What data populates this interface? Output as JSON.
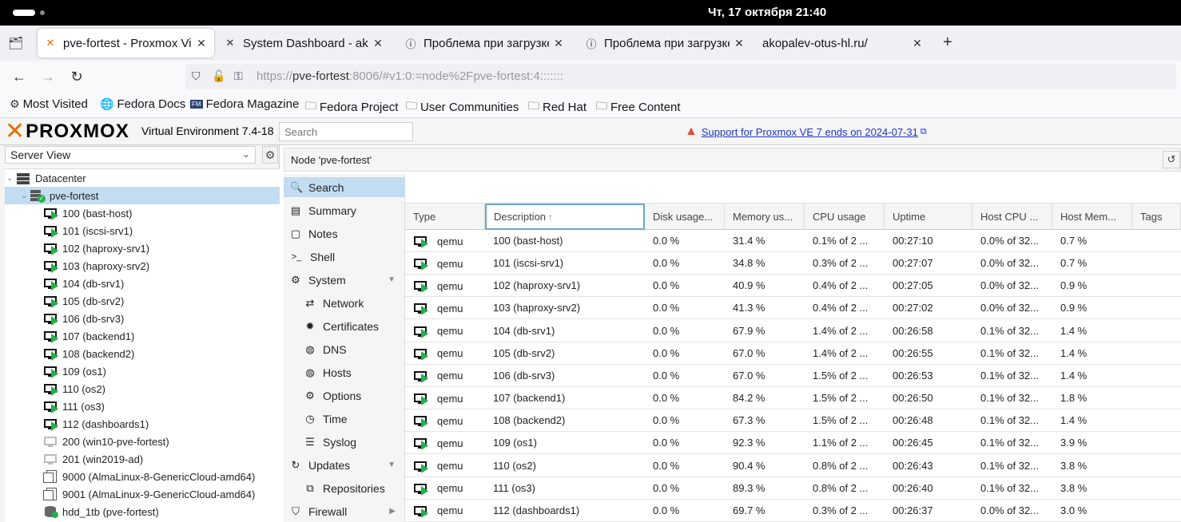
{
  "system": {
    "clock": "Чт, 17 октября  21:40"
  },
  "browser": {
    "tabs": [
      {
        "title": "pve-fortest - Proxmox Virtual Environment",
        "active": true,
        "icon": "proxmox-x-icon"
      },
      {
        "title": "System Dashboard - akopalev",
        "active": false,
        "icon": "jira-icon"
      },
      {
        "title": "Проблема при загрузке страницы",
        "active": false,
        "icon": "info-icon"
      },
      {
        "title": "Проблема при загрузке страницы",
        "active": false,
        "icon": "info-icon"
      },
      {
        "title": "akopalev-otus-hl.ru/",
        "active": false,
        "icon": ""
      }
    ],
    "url_prefix": "https://",
    "url_host": "pve-fortest",
    "url_rest": ":8006/#v1:0:=node%2Fpve-fortest:4:::::::",
    "bookmarks": [
      "Most Visited",
      "Fedora Docs",
      "Fedora Magazine",
      "Fedora Project",
      "User Communities",
      "Red Hat",
      "Free Content"
    ]
  },
  "pve": {
    "logo_text": "PROXMOX",
    "title": "Virtual Environment 7.4-18",
    "search_placeholder": "Search",
    "warning": "Support for Proxmox VE 7 ends on 2024-07-31",
    "view": "Server View",
    "tree": [
      {
        "label": "Datacenter",
        "kind": "datacenter"
      },
      {
        "label": "pve-fortest",
        "kind": "node",
        "selected": true
      },
      {
        "label": "100 (bast-host)",
        "kind": "vm-running"
      },
      {
        "label": "101 (iscsi-srv1)",
        "kind": "vm-running"
      },
      {
        "label": "102 (haproxy-srv1)",
        "kind": "vm-running"
      },
      {
        "label": "103 (haproxy-srv2)",
        "kind": "vm-running"
      },
      {
        "label": "104 (db-srv1)",
        "kind": "vm-running"
      },
      {
        "label": "105 (db-srv2)",
        "kind": "vm-running"
      },
      {
        "label": "106 (db-srv3)",
        "kind": "vm-running"
      },
      {
        "label": "107 (backend1)",
        "kind": "vm-running"
      },
      {
        "label": "108 (backend2)",
        "kind": "vm-running"
      },
      {
        "label": "109 (os1)",
        "kind": "vm-running"
      },
      {
        "label": "110 (os2)",
        "kind": "vm-running"
      },
      {
        "label": "111 (os3)",
        "kind": "vm-running"
      },
      {
        "label": "112 (dashboards1)",
        "kind": "vm-running"
      },
      {
        "label": "200 (win10-pve-fortest)",
        "kind": "vm-stopped"
      },
      {
        "label": "201 (win2019-ad)",
        "kind": "vm-stopped"
      },
      {
        "label": "9000 (AlmaLinux-8-GenericCloud-amd64)",
        "kind": "template"
      },
      {
        "label": "9001 (AlmaLinux-9-GenericCloud-amd64)",
        "kind": "template"
      },
      {
        "label": "hdd_1tb (pve-fortest)",
        "kind": "storage"
      }
    ],
    "node_header": "Node 'pve-fortest'",
    "menu": [
      {
        "label": "Search",
        "icon": "search-icon",
        "glyph": "🔍",
        "selected": true
      },
      {
        "label": "Summary",
        "icon": "book-icon",
        "glyph": "▤"
      },
      {
        "label": "Notes",
        "icon": "notes-icon",
        "glyph": "▢"
      },
      {
        "label": "Shell",
        "icon": "terminal-icon",
        "glyph": ">_"
      },
      {
        "label": "System",
        "icon": "cogs-icon",
        "glyph": "⚙",
        "expandable": true
      },
      {
        "label": "Network",
        "icon": "exchange-icon",
        "glyph": "⇄",
        "sub": true
      },
      {
        "label": "Certificates",
        "icon": "certificate-icon",
        "glyph": "✹",
        "sub": true
      },
      {
        "label": "DNS",
        "icon": "globe-icon",
        "glyph": "◍",
        "sub": true
      },
      {
        "label": "Hosts",
        "icon": "globe-icon",
        "glyph": "◍",
        "sub": true
      },
      {
        "label": "Options",
        "icon": "gear-icon",
        "glyph": "⚙",
        "sub": true
      },
      {
        "label": "Time",
        "icon": "clock-icon",
        "glyph": "◷",
        "sub": true
      },
      {
        "label": "Syslog",
        "icon": "list-icon",
        "glyph": "☰",
        "sub": true
      },
      {
        "label": "Updates",
        "icon": "refresh-icon",
        "glyph": "↻",
        "expandable": true
      },
      {
        "label": "Repositories",
        "icon": "files-icon",
        "glyph": "⧉",
        "sub": true
      },
      {
        "label": "Firewall",
        "icon": "shield-icon",
        "glyph": "⛉",
        "collapsed": true
      }
    ],
    "columns": [
      "Type",
      "Description",
      "Disk usage...",
      "Memory us...",
      "CPU usage",
      "Uptime",
      "Host CPU ...",
      "Host Mem...",
      "Tags"
    ],
    "sort_arrow": "↑",
    "rows": [
      {
        "type": "qemu",
        "desc": "100 (bast-host)",
        "disk": "0.0 %",
        "mem": "31.4 %",
        "cpu": "0.1% of 2 ...",
        "uptime": "00:27:10",
        "hcpu": "0.0% of 32...",
        "hmem": "0.7 %"
      },
      {
        "type": "qemu",
        "desc": "101 (iscsi-srv1)",
        "disk": "0.0 %",
        "mem": "34.8 %",
        "cpu": "0.3% of 2 ...",
        "uptime": "00:27:07",
        "hcpu": "0.0% of 32...",
        "hmem": "0.7 %"
      },
      {
        "type": "qemu",
        "desc": "102 (haproxy-srv1)",
        "disk": "0.0 %",
        "mem": "40.9 %",
        "cpu": "0.4% of 2 ...",
        "uptime": "00:27:05",
        "hcpu": "0.0% of 32...",
        "hmem": "0.9 %"
      },
      {
        "type": "qemu",
        "desc": "103 (haproxy-srv2)",
        "disk": "0.0 %",
        "mem": "41.3 %",
        "cpu": "0.4% of 2 ...",
        "uptime": "00:27:02",
        "hcpu": "0.0% of 32...",
        "hmem": "0.9 %"
      },
      {
        "type": "qemu",
        "desc": "104 (db-srv1)",
        "disk": "0.0 %",
        "mem": "67.9 %",
        "cpu": "1.4% of 2 ...",
        "uptime": "00:26:58",
        "hcpu": "0.1% of 32...",
        "hmem": "1.4 %"
      },
      {
        "type": "qemu",
        "desc": "105 (db-srv2)",
        "disk": "0.0 %",
        "mem": "67.0 %",
        "cpu": "1.4% of 2 ...",
        "uptime": "00:26:55",
        "hcpu": "0.1% of 32...",
        "hmem": "1.4 %"
      },
      {
        "type": "qemu",
        "desc": "106 (db-srv3)",
        "disk": "0.0 %",
        "mem": "67.0 %",
        "cpu": "1.5% of 2 ...",
        "uptime": "00:26:53",
        "hcpu": "0.1% of 32...",
        "hmem": "1.4 %"
      },
      {
        "type": "qemu",
        "desc": "107 (backend1)",
        "disk": "0.0 %",
        "mem": "84.2 %",
        "cpu": "1.5% of 2 ...",
        "uptime": "00:26:50",
        "hcpu": "0.1% of 32...",
        "hmem": "1.8 %"
      },
      {
        "type": "qemu",
        "desc": "108 (backend2)",
        "disk": "0.0 %",
        "mem": "67.3 %",
        "cpu": "1.5% of 2 ...",
        "uptime": "00:26:48",
        "hcpu": "0.1% of 32...",
        "hmem": "1.4 %"
      },
      {
        "type": "qemu",
        "desc": "109 (os1)",
        "disk": "0.0 %",
        "mem": "92.3 %",
        "cpu": "1.1% of 2 ...",
        "uptime": "00:26:45",
        "hcpu": "0.1% of 32...",
        "hmem": "3.9 %"
      },
      {
        "type": "qemu",
        "desc": "110 (os2)",
        "disk": "0.0 %",
        "mem": "90.4 %",
        "cpu": "0.8% of 2 ...",
        "uptime": "00:26:43",
        "hcpu": "0.1% of 32...",
        "hmem": "3.8 %"
      },
      {
        "type": "qemu",
        "desc": "111 (os3)",
        "disk": "0.0 %",
        "mem": "89.3 %",
        "cpu": "0.8% of 2 ...",
        "uptime": "00:26:40",
        "hcpu": "0.1% of 32...",
        "hmem": "3.8 %"
      },
      {
        "type": "qemu",
        "desc": "112 (dashboards1)",
        "disk": "0.0 %",
        "mem": "69.7 %",
        "cpu": "0.3% of 2 ...",
        "uptime": "00:26:37",
        "hcpu": "0.0% of 32...",
        "hmem": "3.0 %"
      }
    ]
  },
  "colors": {
    "accent": "#e57000",
    "selection": "#c2ddf2",
    "running": "#22b14c",
    "link": "#1e33c8",
    "warning": "#e04b3a"
  }
}
